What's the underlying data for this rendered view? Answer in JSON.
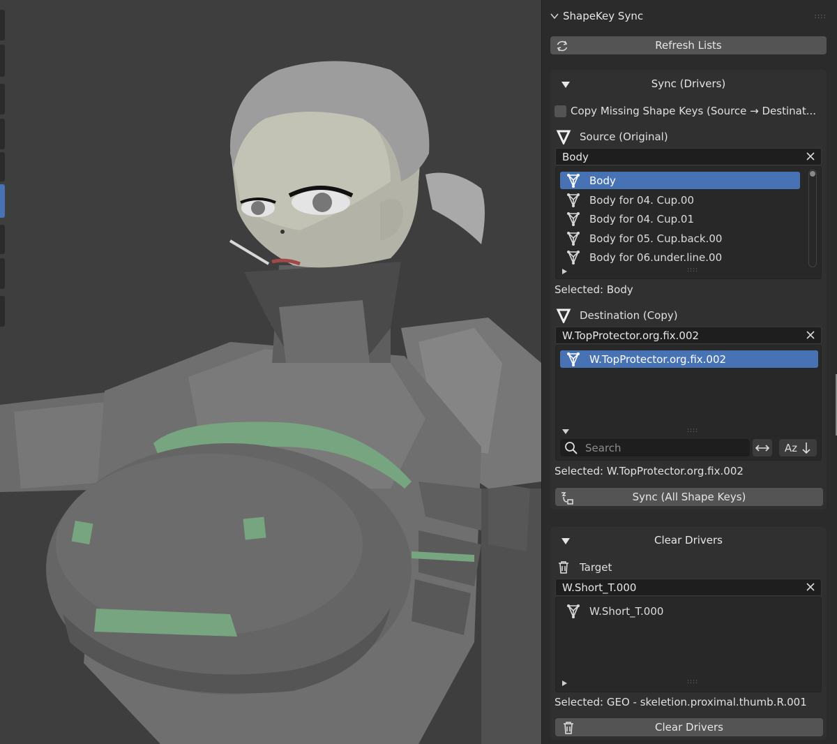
{
  "panel": {
    "title": "ShapeKey Sync",
    "refresh_label": "Refresh Lists"
  },
  "sync": {
    "title": "Sync (Drivers)",
    "copy_missing_label": "Copy Missing Shape Keys (Source → Destinat...",
    "copy_missing_checked": false,
    "source": {
      "label": "Source (Original)",
      "field_value": "Body",
      "items": [
        "Body",
        "Body for 04. Cup.00",
        "Body for 04. Cup.01",
        "Body for 05. Cup.back.00",
        "Body for 06.under.line.00"
      ],
      "selected_index": 0,
      "selected_text": "Selected: Body"
    },
    "destination": {
      "label": "Destination (Copy)",
      "field_value": "W.TopProtector.org.fix.002",
      "items": [
        "W.TopProtector.org.fix.002"
      ],
      "selected_index": 0,
      "search_placeholder": "Search",
      "sort_label": "Az",
      "selected_text": "Selected: W.TopProtector.org.fix.002"
    },
    "sync_all_label": "Sync (All Shape Keys)"
  },
  "clear": {
    "title": "Clear Drivers",
    "target_label": "Target",
    "field_value": "W.Short_T.000",
    "items": [
      "W.Short_T.000"
    ],
    "selected_text": "Selected: GEO - skeletion.proximal.thumb.R.001",
    "clear_button_label": "Clear Drivers"
  },
  "colors": {
    "accent": "#4772b3",
    "panel_bg": "#2b2b2b",
    "viewport_bg": "#3f3f3f"
  }
}
